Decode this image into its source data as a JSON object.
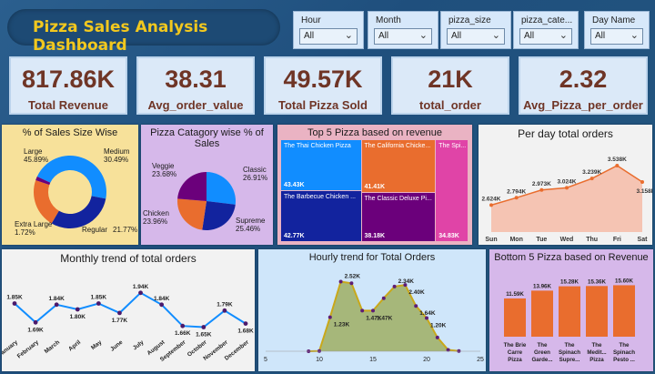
{
  "title": "Pizza Sales Analysis Dashboard",
  "slicers": [
    {
      "label": "Hour",
      "value": "All"
    },
    {
      "label": "Month",
      "value": "All"
    },
    {
      "label": "pizza_size",
      "value": "All"
    },
    {
      "label": "pizza_cate...",
      "value": "All"
    },
    {
      "label": "Day Name",
      "value": "All"
    }
  ],
  "chevron": "⌄",
  "kpis": [
    {
      "value": "817.86K",
      "name": "Total Revenue"
    },
    {
      "value": "38.31",
      "name": "Avg_order_value"
    },
    {
      "value": "49.57K",
      "name": "Total Pizza Sold"
    },
    {
      "value": "21K",
      "name": "total_order"
    },
    {
      "value": "2.32",
      "name": "Avg_Pizza_per_order"
    }
  ],
  "colors": {
    "accent": "#f2c81e",
    "kpi_text": "#6f3526",
    "orange": "#e96d2e",
    "blue": "#118dff",
    "navy": "#12239e",
    "purple": "#6b007b",
    "pink": "#e044a7"
  },
  "chart_data": [
    {
      "type": "pie",
      "title": "% of Sales Size Wise",
      "donut": true,
      "slices": [
        {
          "name": "Large",
          "label": "45.89%"
        },
        {
          "name": "Medium",
          "label": "30.49%"
        },
        {
          "name": "Regular",
          "label": "21.77%"
        },
        {
          "name": "Extra Large",
          "label": "1.72%"
        }
      ],
      "values": [
        45.89,
        30.49,
        21.77,
        1.72
      ]
    },
    {
      "type": "pie",
      "title": "Pizza Catagory wise % of Sales",
      "slices": [
        {
          "name": "Classic",
          "label": "26.91%"
        },
        {
          "name": "Supreme",
          "label": "25.46%"
        },
        {
          "name": "Chicken",
          "label": "23.96%"
        },
        {
          "name": "Veggie",
          "label": "23.68%"
        }
      ],
      "values": [
        26.91,
        25.46,
        23.96,
        23.68
      ]
    },
    {
      "type": "heatmap",
      "title": "Top 5 Pizza based on revenue",
      "items": [
        {
          "name": "The Thai Chicken Pizza",
          "label": "43.43K",
          "value": 43.43
        },
        {
          "name": "The Barbecue Chicken ...",
          "label": "42.77K",
          "value": 42.77
        },
        {
          "name": "The California Chicke...",
          "label": "41.41K",
          "value": 41.41
        },
        {
          "name": "The Classic Deluxe Pi...",
          "label": "38.18K",
          "value": 38.18
        },
        {
          "name": "The Spi...",
          "label": "34.83K",
          "value": 34.83
        }
      ]
    },
    {
      "type": "area",
      "title": "Per day total orders",
      "categories": [
        "Sun",
        "Mon",
        "Tue",
        "Wed",
        "Thu",
        "Fri",
        "Sat"
      ],
      "values": [
        2624,
        2794,
        2973,
        3024,
        3239,
        3538,
        3158
      ],
      "labels": [
        "2.624K",
        "2.794K",
        "2.973K",
        "3.024K",
        "3.239K",
        "3.538K",
        "3.158K"
      ]
    },
    {
      "type": "line",
      "title": "Monthly trend of total orders",
      "categories": [
        "January",
        "February",
        "March",
        "April",
        "May",
        "June",
        "July",
        "August",
        "September",
        "October",
        "November",
        "December"
      ],
      "values": [
        1.85,
        1.69,
        1.84,
        1.8,
        1.85,
        1.77,
        1.94,
        1.84,
        1.66,
        1.65,
        1.79,
        1.68
      ],
      "labels": [
        "1.85K",
        "1.69K",
        "1.84K",
        "1.80K",
        "1.85K",
        "1.77K",
        "1.94K",
        "1.84K",
        "1.66K",
        "1.65K",
        "1.79K",
        "1.68K"
      ]
    },
    {
      "type": "area",
      "title": "Hourly trend for Total Orders",
      "x": [
        9,
        10,
        11,
        12,
        13,
        14,
        15,
        16,
        17,
        18,
        19,
        20,
        21,
        22,
        23
      ],
      "values": [
        0.001,
        0.01,
        1.23,
        2.52,
        2.46,
        1.47,
        1.47,
        1.92,
        2.34,
        2.4,
        1.64,
        1.2,
        0.5,
        0.05,
        0.01
      ],
      "point_labels": [
        {
          "i": 2,
          "t": "1.23K"
        },
        {
          "i": 3,
          "t": "2.52K"
        },
        {
          "i": 5,
          "t": "1.47K"
        },
        {
          "i": 6,
          "t": "1.47K"
        },
        {
          "i": 8,
          "t": "2.34K"
        },
        {
          "i": 9,
          "t": "2.40K"
        },
        {
          "i": 10,
          "t": "1.64K"
        },
        {
          "i": 11,
          "t": "1.20K"
        }
      ],
      "xticks": [
        5,
        10,
        15,
        20,
        25
      ],
      "xlim": [
        5,
        25
      ]
    },
    {
      "type": "bar",
      "title": "Bottom 5 Pizza based on Revenue",
      "categories": [
        [
          "The Brie",
          "Carre",
          "Pizza"
        ],
        [
          "The",
          "Green",
          "Garde..."
        ],
        [
          "The",
          "Spinach",
          "Supre..."
        ],
        [
          "The",
          "Medit...",
          "Pizza"
        ],
        [
          "The",
          "Spinach",
          "Pesto ..."
        ]
      ],
      "values": [
        11.59,
        13.96,
        15.28,
        15.36,
        15.6
      ],
      "labels": [
        "11.59K",
        "13.96K",
        "15.28K",
        "15.36K",
        "15.60K"
      ]
    }
  ]
}
